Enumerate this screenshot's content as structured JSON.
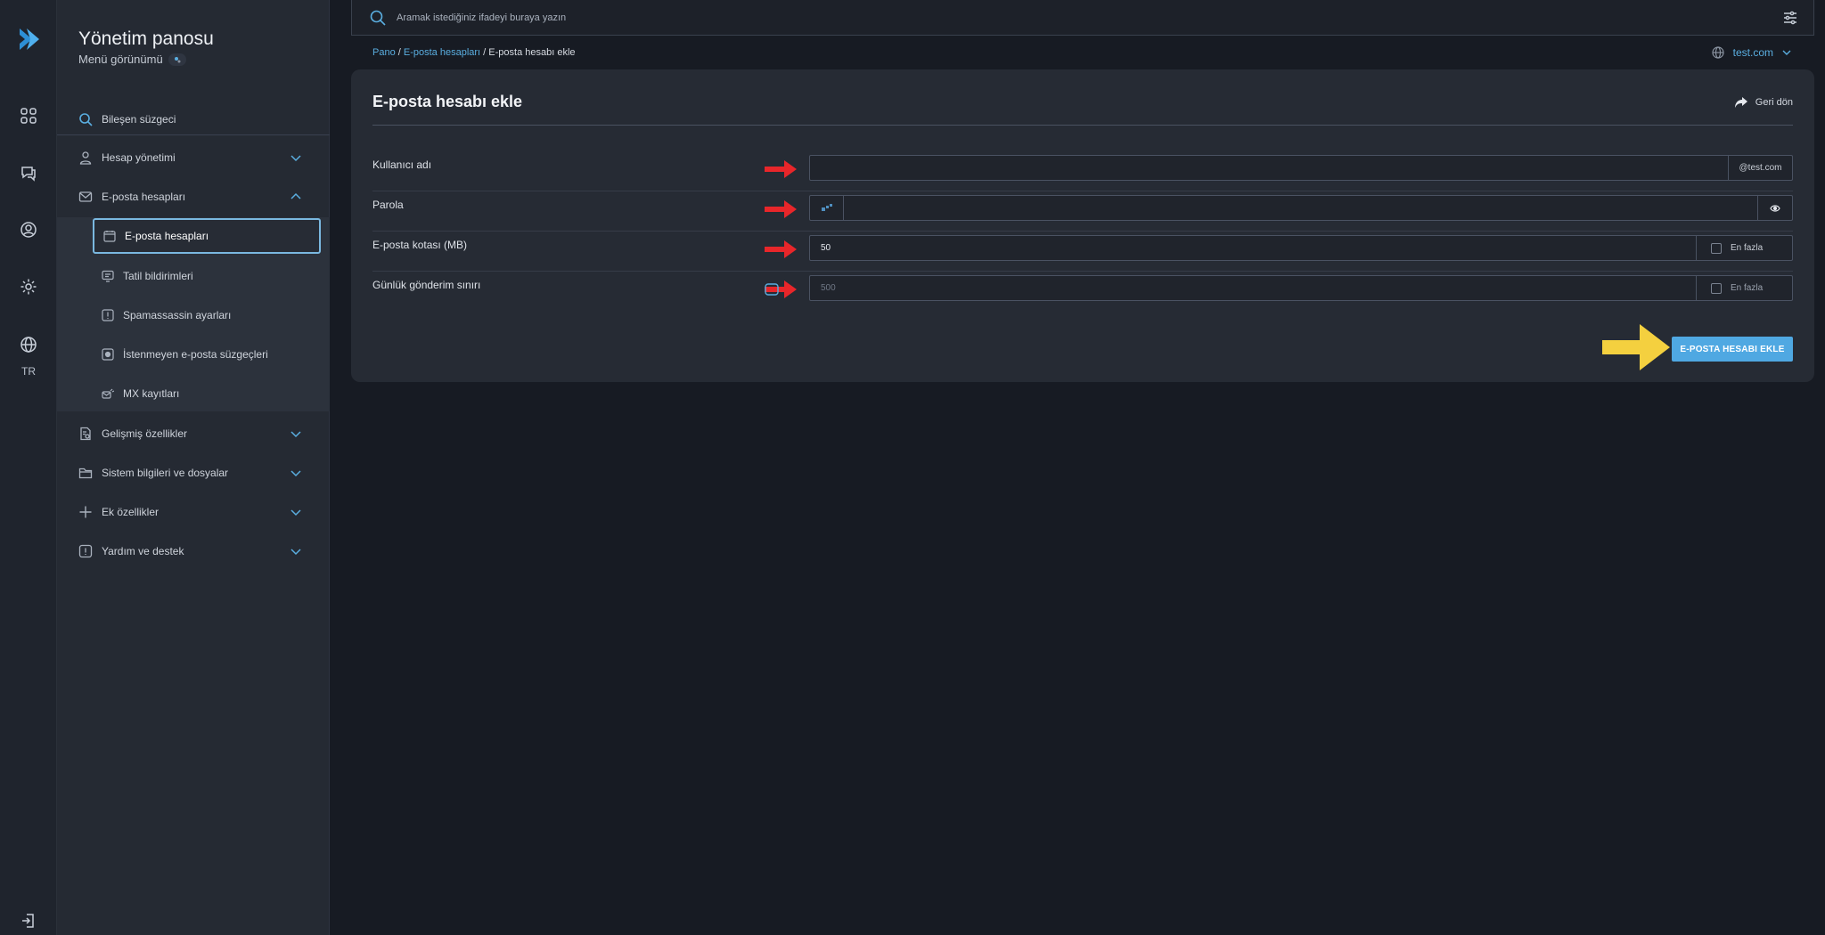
{
  "app": {
    "title": "Yönetim panosu",
    "subtitle": "Menü görünümü",
    "language": "TR"
  },
  "search": {
    "filter_placeholder": "Bileşen süzgeci",
    "top_placeholder": "Aramak istediğiniz ifadeyi buraya yazın"
  },
  "sidebar": {
    "items": [
      {
        "label": "Hesap yönetimi",
        "icon": "user-icon"
      },
      {
        "label": "E-posta hesapları",
        "icon": "envelope-icon"
      },
      {
        "label": "Gelişmiş özellikler",
        "icon": "advanced-doc-icon"
      },
      {
        "label": "Sistem bilgileri ve dosyalar",
        "icon": "folder-icon"
      },
      {
        "label": "Ek özellikler",
        "icon": "plus-icon"
      },
      {
        "label": "Yardım ve destek",
        "icon": "help-icon"
      }
    ],
    "subitems": [
      {
        "label": "E-posta hesapları",
        "icon": "calendar-icon"
      },
      {
        "label": "Tatil bildirimleri",
        "icon": "monitor-icon"
      },
      {
        "label": "Spamassassin ayarları",
        "icon": "alert-icon"
      },
      {
        "label": "İstenmeyen e-posta süzgeçleri",
        "icon": "filter-box-icon"
      },
      {
        "label": "MX kayıtları",
        "icon": "mail-server-icon"
      }
    ]
  },
  "breadcrumb": {
    "home": "Pano",
    "parent": "E-posta hesapları",
    "current": "E-posta hesabı ekle"
  },
  "domain_selector": "test.com",
  "form": {
    "title": "E-posta hesabı ekle",
    "back_label": "Geri dön",
    "username_label": "Kullanıcı adı",
    "username_value": "",
    "username_suffix": "@test.com",
    "password_label": "Parola",
    "password_value": "",
    "quota_label": "E-posta kotası (MB)",
    "quota_value": "50",
    "quota_max_label": "En fazla",
    "send_limit_label": "Günlük gönderim sınırı",
    "send_limit_placeholder": "500",
    "send_limit_max_label": "En fazla",
    "submit_label": "E-POSTA HESABI EKLE"
  },
  "colors": {
    "accent": "#4fa8e2",
    "annotation_red": "#e8262a",
    "annotation_yellow": "#f4d03f"
  }
}
